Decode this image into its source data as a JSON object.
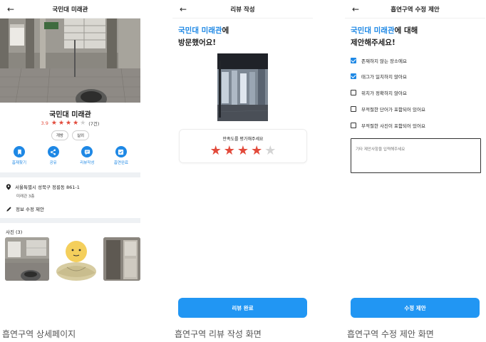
{
  "detail": {
    "title": "국민대 미래관",
    "place_name": "국민대 미래관",
    "rating": "3.9",
    "stars": 4,
    "review_count": "(7건)",
    "tags": [
      "개방",
      "실외"
    ],
    "actions": [
      {
        "label": "흡재찾기",
        "icon": "bookmark-icon"
      },
      {
        "label": "공유",
        "icon": "share-icon"
      },
      {
        "label": "리뷰작성",
        "icon": "chat-icon"
      },
      {
        "label": "흡연완료",
        "icon": "check-icon"
      }
    ],
    "address": "서울특별시 성북구 정릉동 861-1",
    "address_sub": "미래관 3층",
    "edit_suggest": "정보 수정 제안",
    "photos_title": "사진 (3)",
    "caption": "흡연구역 상세페이지"
  },
  "review": {
    "title": "리뷰 작성",
    "heading_highlight": "국민대 미래관",
    "heading_suffix": "에",
    "heading_line2": "방문했어요!",
    "rate_label": "만족도를 평가해주세요",
    "stars": 4,
    "submit_label": "리뷰 완료",
    "caption": "흡연구역 리뷰 작성 화면"
  },
  "suggest": {
    "title": "흡연구역 수정 제안",
    "heading_highlight": "국민대 미래관",
    "heading_suffix": "에 대해",
    "heading_line2": "제안해주세요!",
    "options": [
      {
        "label": "존재하지 않는 장소에요",
        "checked": true
      },
      {
        "label": "태그가 일치하지 않아요",
        "checked": true
      },
      {
        "label": "위치가 정확하지 않아요",
        "checked": false
      },
      {
        "label": "부적절한 단어가 포함되어 있어요",
        "checked": false
      },
      {
        "label": "부적절한 사진이 포함되어 있어요",
        "checked": false
      }
    ],
    "etc_placeholder": "기타 제안사항을 입력해주세요",
    "submit_label": "수정 제안",
    "caption": "흡연구역 수정 제안 화면"
  },
  "colors": {
    "accent": "#1e88e5",
    "button": "#2196f3",
    "star": "#e24a3b"
  }
}
